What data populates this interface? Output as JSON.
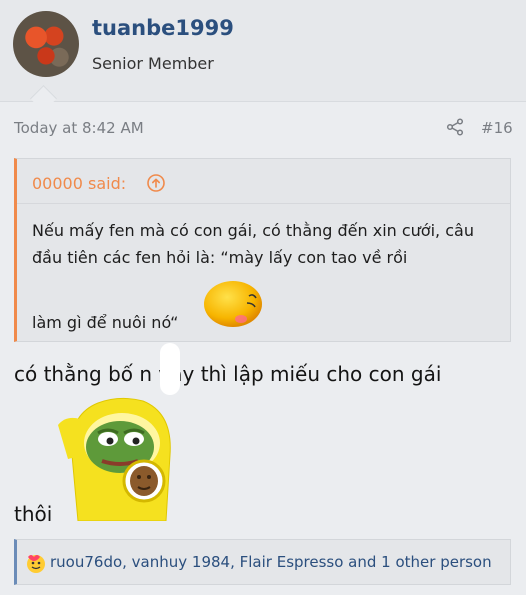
{
  "user": {
    "name": "tuanbe1999",
    "title": "Senior Member"
  },
  "post": {
    "time": "Today at 8:42 AM",
    "number": "#16",
    "quote": {
      "author_label": "00000 said:",
      "text": "Nếu mấy fen mà có con gái, có thằng đến xin cưới, câu đầu tiên các fen hỏi là: “mày lấy con tao về rồi",
      "text_last": "làm gì để nuôi nó“"
    },
    "body_line1": "có thằng bố n     vậy thì lập miếu cho con gái",
    "body_line2": "thôi"
  },
  "reactions": {
    "text": "ruou76do, vanhuy 1984, Flair Espresso and 1 other person"
  },
  "colors": {
    "accent_orange": "#f08a4b",
    "link_blue": "#2b4f7e",
    "meta_gray": "#7a7e84"
  },
  "icons": [
    "share-icon",
    "arrow-up-circle-icon",
    "emoji-sweat-icon",
    "pepe-sticker",
    "reaction-icon"
  ]
}
